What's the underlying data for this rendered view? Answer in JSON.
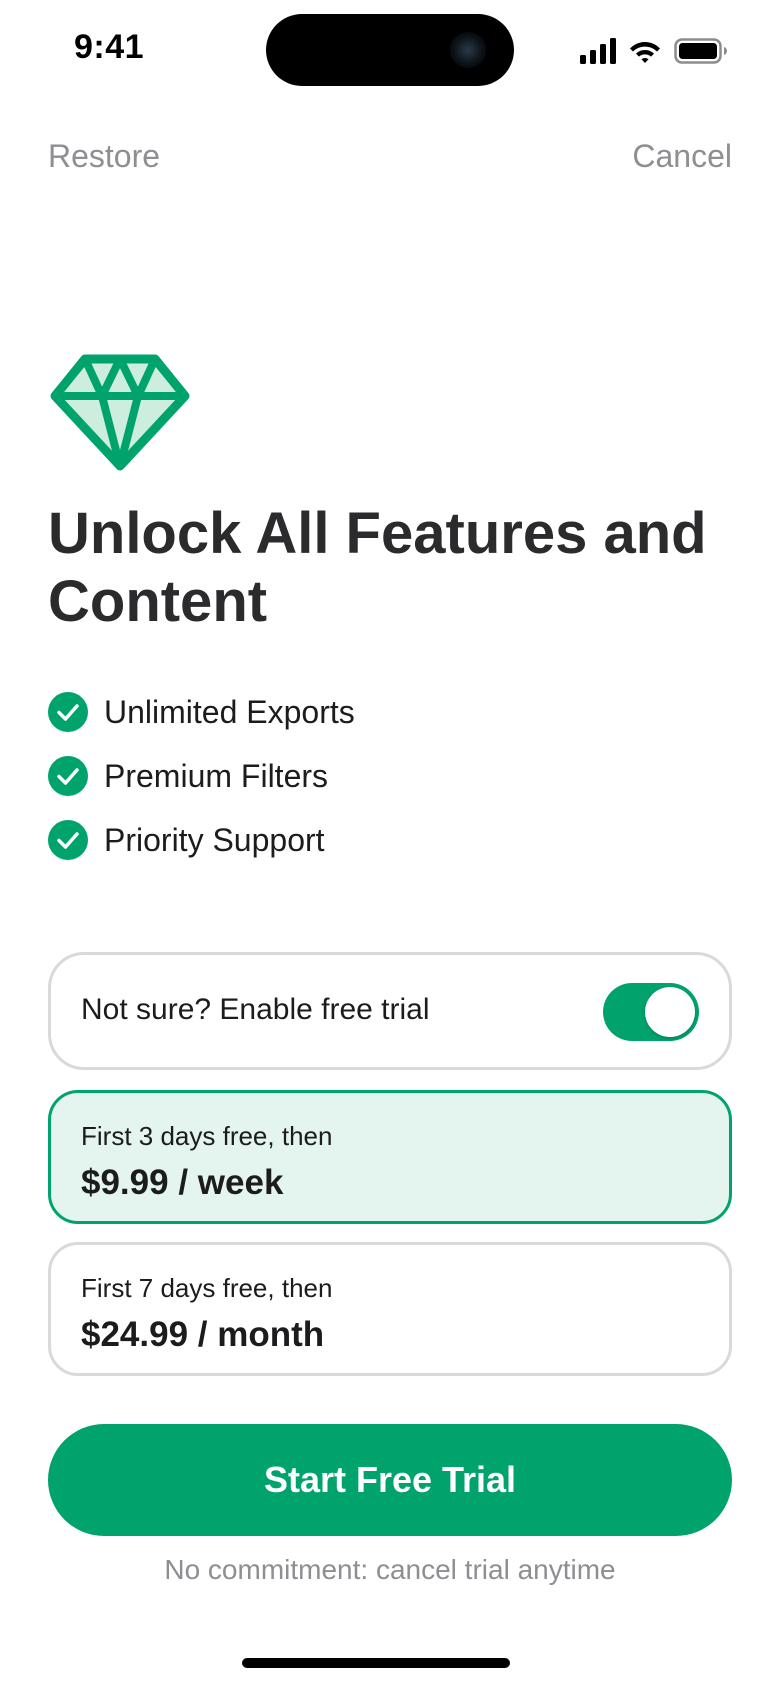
{
  "status_bar": {
    "time": "9:41",
    "icons": [
      "cellular-signal-icon",
      "wifi-icon",
      "battery-icon"
    ]
  },
  "nav": {
    "restore_label": "Restore",
    "cancel_label": "Cancel"
  },
  "hero": {
    "icon": "diamond-icon",
    "headline": "Unlock All Features and Content"
  },
  "features": [
    {
      "label": "Unlimited Exports",
      "icon": "check-circle-icon"
    },
    {
      "label": "Premium Filters",
      "icon": "check-circle-icon"
    },
    {
      "label": "Priority Support",
      "icon": "check-circle-icon"
    }
  ],
  "trial_toggle": {
    "label": "Not sure? Enable free trial",
    "enabled": true
  },
  "plans": [
    {
      "subtitle": "First 3 days free, then",
      "price": "$9.99",
      "separator": "/",
      "period": "week",
      "selected": true
    },
    {
      "subtitle": "First 7 days free, then",
      "price": "$24.99",
      "separator": "/",
      "period": "month",
      "selected": false
    }
  ],
  "cta": {
    "label": "Start Free Trial"
  },
  "footnote": "No commitment: cancel trial anytime",
  "colors": {
    "accent": "#00a36c",
    "accent_light": "#e4f4ee",
    "muted_text": "#8e8e93",
    "heading_text": "#2b2b2e",
    "card_border": "#d9d9dc"
  }
}
